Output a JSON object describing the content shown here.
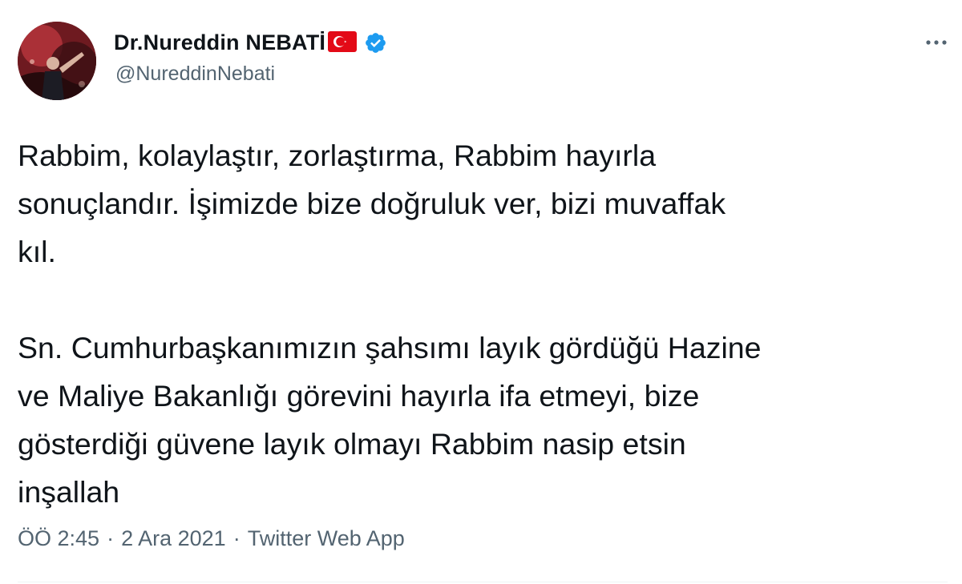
{
  "author": {
    "display_name": "Dr.Nureddin NEBATİ",
    "handle": "@NureddinNebati",
    "verified": true,
    "flag": "turkey-flag-icon"
  },
  "tweet": {
    "paragraph_1": "Rabbim, kolaylaştır, zorlaştırma, Rabbim hayırla\nsonuçlandır. İşimizde bize doğruluk ver, bizi muvaffak\nkıl.",
    "paragraph_2": "Sn. Cumhurbaşkanımızın şahsımı layık gördüğü Hazine\nve Maliye Bakanlığı görevini hayırla ifa etmeyi, bize\ngösterdiği güvene layık olmayı Rabbim nasip etsin\ninşallah"
  },
  "meta": {
    "time": "ÖÖ 2:45",
    "separator": "·",
    "date": "2 Ara 2021",
    "source": "Twitter Web App"
  },
  "colors": {
    "text": "#0f1419",
    "secondary": "#536471",
    "verified": "#1d9bf0",
    "flag_red": "#e30a17"
  },
  "icons": {
    "more": "more-horizontal-icon",
    "verified": "verified-badge-icon"
  }
}
